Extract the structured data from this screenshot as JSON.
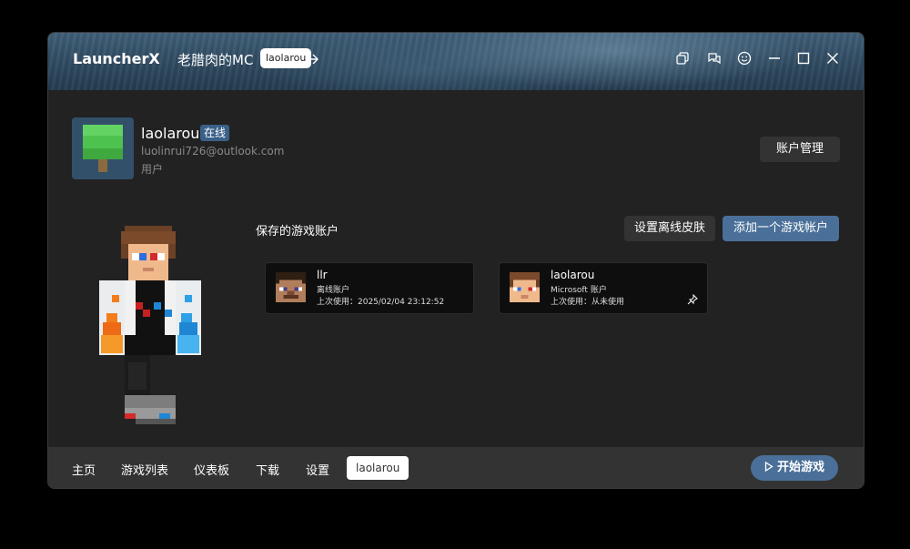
{
  "app": {
    "title": "LauncherX"
  },
  "header": {
    "profile_name": "老腊肉的MC",
    "profile_chip": "laolarou"
  },
  "account": {
    "name": "laolarou",
    "status": "在线",
    "email": "luolinrui726@outlook.com",
    "role": "用户",
    "manage_label": "账户管理"
  },
  "saved": {
    "title": "保存的游戏账户",
    "set_skin_label": "设置离线皮肤",
    "add_account_label": "添加一个游戏帐户",
    "accounts": [
      {
        "name": "llr",
        "type": "离线账户",
        "last_used": "上次使用：2025/02/04 23:12:52",
        "icon": "steve-head"
      },
      {
        "name": "laolarou",
        "type": "Microsoft 账户",
        "last_used": "上次使用：从未使用",
        "icon": "player-head"
      }
    ]
  },
  "nav": {
    "items": [
      "主页",
      "游戏列表",
      "仪表板",
      "下载",
      "设置"
    ],
    "active": "laolarou",
    "play_label": "开始游戏"
  },
  "colors": {
    "accent": "#4a7099",
    "badge": "#3b6088",
    "window_bg": "#222222",
    "bar_bg": "#333333"
  }
}
